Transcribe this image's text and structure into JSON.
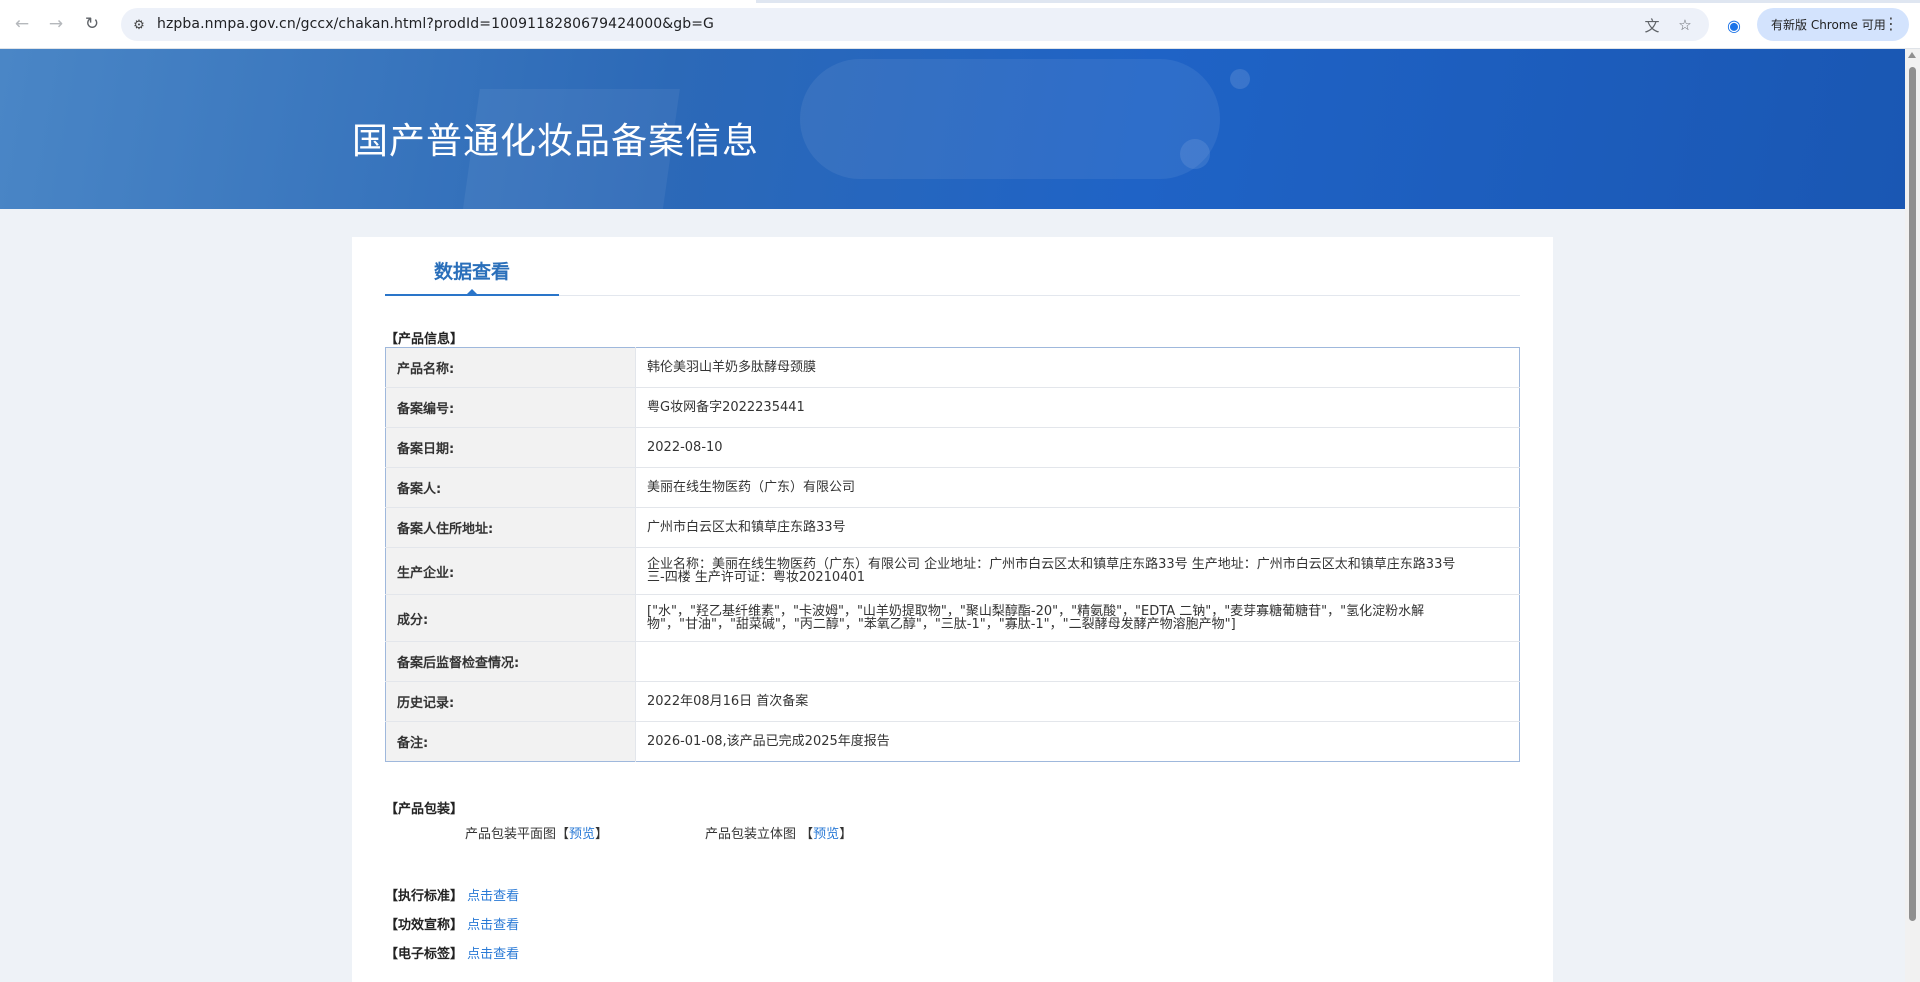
{
  "browser": {
    "url": "hzpba.nmpa.gov.cn/gccx/chakan.html?prodId=1009118280679424000&gb=G",
    "update_label": "有新版 Chrome 可用",
    "back_icon": "arrow-left-icon",
    "forward_icon": "arrow-right-icon",
    "reload_icon": "reload-icon"
  },
  "banner": {
    "title": "国产普通化妆品备案信息"
  },
  "tabs": [
    {
      "label": "数据查看"
    }
  ],
  "product_info": {
    "section_label": "【产品信息】",
    "rows": [
      {
        "key": "产品名称:",
        "value": "韩伦美羽山羊奶多肽酵母颈膜"
      },
      {
        "key": "备案编号:",
        "value": "粤G妆网备字2022235441"
      },
      {
        "key": "备案日期:",
        "value": "2022-08-10"
      },
      {
        "key": "备案人:",
        "value": "美丽在线生物医药（广东）有限公司"
      },
      {
        "key": "备案人住所地址:",
        "value": "广州市白云区太和镇草庄东路33号"
      },
      {
        "key": "生产企业:",
        "value": "企业名称：美丽在线生物医药（广东）有限公司 企业地址：广州市白云区太和镇草庄东路33号 生产地址：广州市白云区太和镇草庄东路33号三-四楼 生产许可证：粤妆20210401"
      },
      {
        "key": "成分:",
        "value": "[\"水\"，\"羟乙基纤维素\"，\"卡波姆\"，\"山羊奶提取物\"，\"聚山梨醇酯-20\"，\"精氨酸\"，\"EDTA 二钠\"，\"麦芽寡糖葡糖苷\"，\"氢化淀粉水解物\"，\"甘油\"，\"甜菜碱\"，\"丙二醇\"，\"苯氧乙醇\"，\"三肽-1\"，\"寡肽-1\"，\"二裂酵母发酵产物溶胞产物\"]"
      },
      {
        "key": "备案后监督检查情况:",
        "value": ""
      },
      {
        "key": "历史记录:",
        "value": "2022年08月16日 首次备案"
      },
      {
        "key": "备注:",
        "value": "2026-01-08,该产品已完成2025年度报告"
      }
    ]
  },
  "packaging": {
    "section_label": "【产品包装】",
    "flat_label": "产品包装平面图",
    "solid_label": "产品包装立体图",
    "bracket_open": "【",
    "bracket_close": "】",
    "preview_link": "预览"
  },
  "documents": [
    {
      "label": "【执行标准】",
      "link": "点击查看"
    },
    {
      "label": "【功效宣称】",
      "link": "点击查看"
    },
    {
      "label": "【电子标签】",
      "link": "点击查看"
    }
  ]
}
